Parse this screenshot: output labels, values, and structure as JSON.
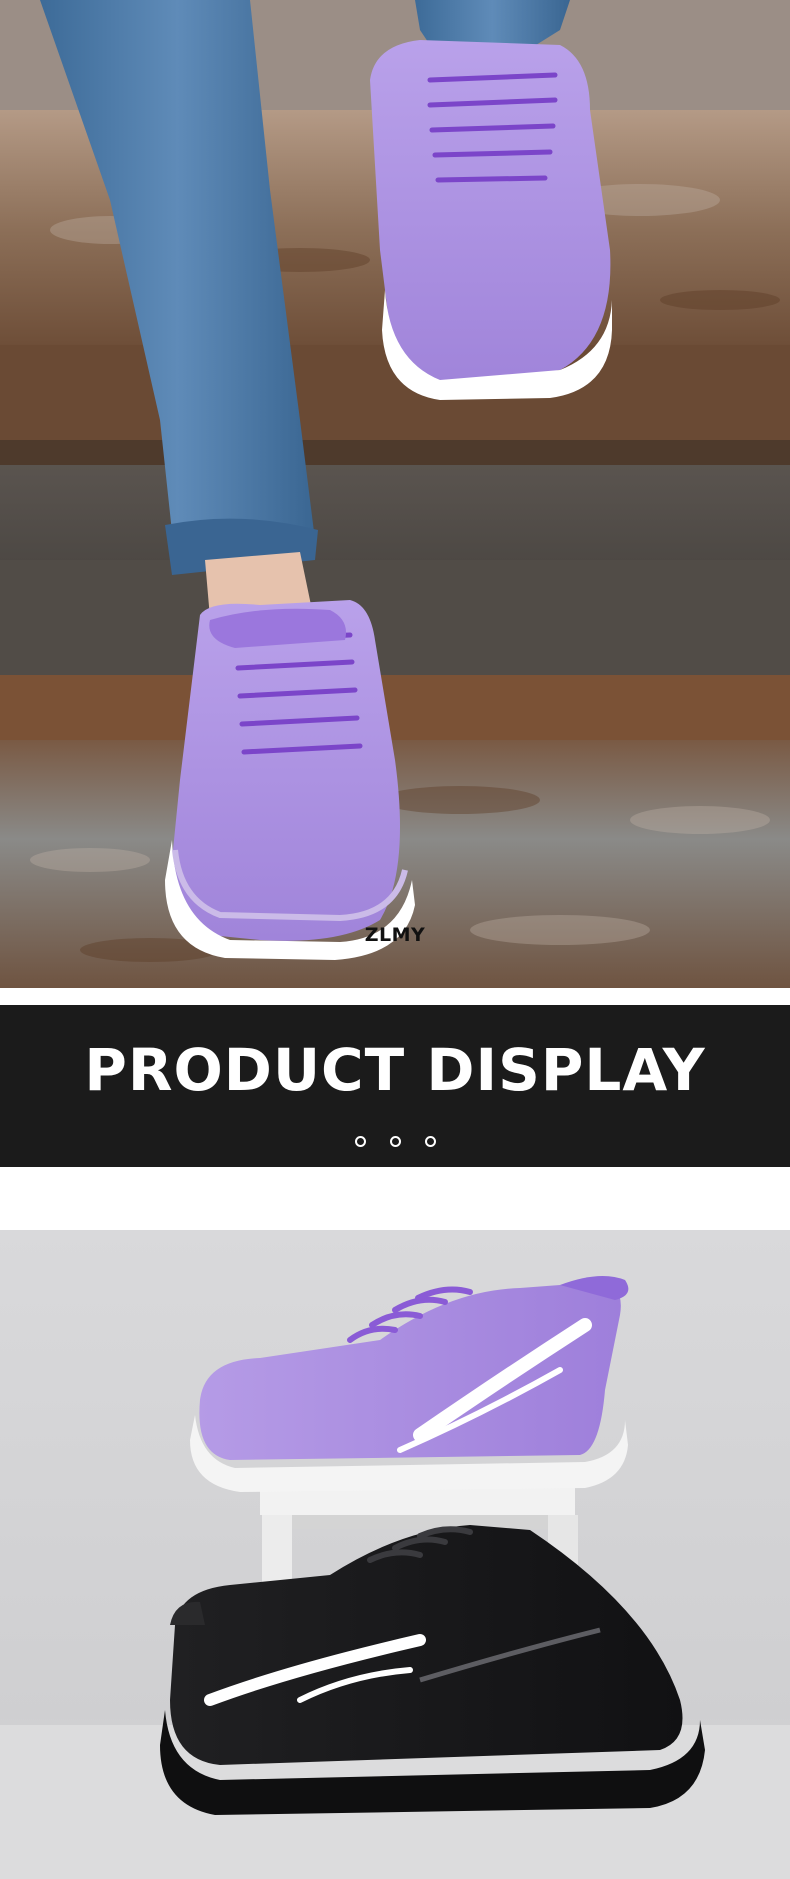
{
  "hero": {
    "brand_mark": "ZLMY"
  },
  "banner": {
    "title": "PRODUCT DISPLAY",
    "indicator_dots": 3
  },
  "colors": {
    "banner_background": "#1b1b1b",
    "shoe_primary": "#a98ee0",
    "shoe_secondary": "#1c1c1c",
    "backdrop": "#d6d6d8"
  }
}
